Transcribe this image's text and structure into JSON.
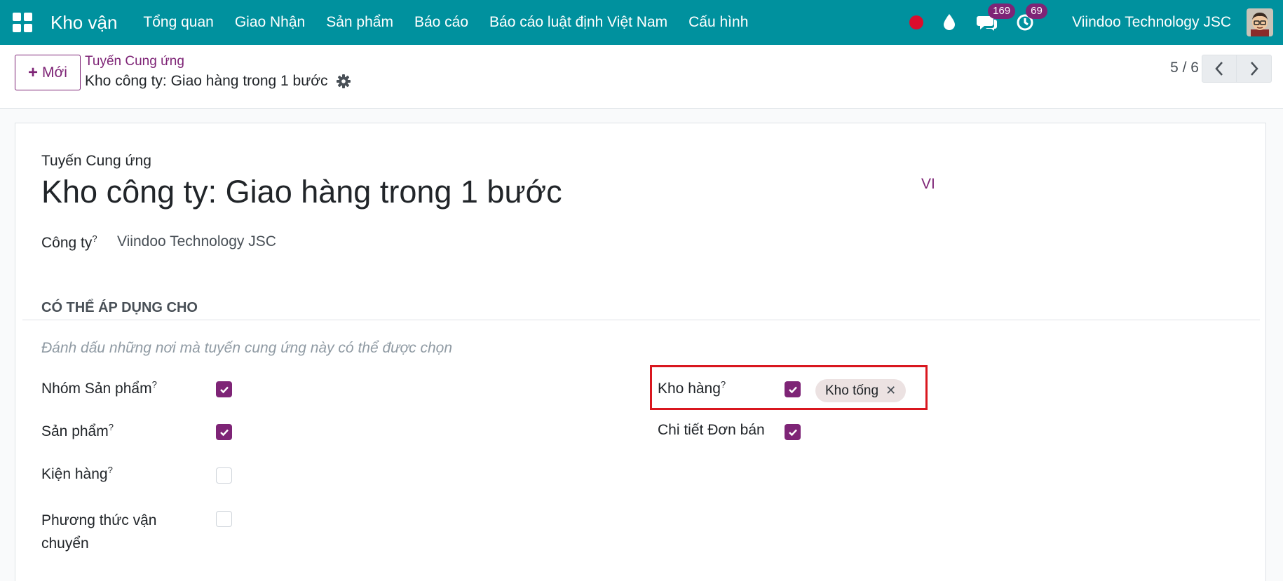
{
  "navbar": {
    "app_name": "Kho vận",
    "menu": [
      "Tổng quan",
      "Giao Nhận",
      "Sản phẩm",
      "Báo cáo",
      "Báo cáo luật định Việt Nam",
      "Cấu hình"
    ],
    "messages_count": "169",
    "activities_count": "69",
    "company": "Viindoo Technology JSC"
  },
  "control": {
    "new_label": "Mới",
    "breadcrumb_parent": "Tuyến Cung ứng",
    "breadcrumb_current": "Kho công ty: Giao hàng trong 1 bước",
    "pager": "5 / 6"
  },
  "form": {
    "subtitle": "Tuyến Cung ứng",
    "title": "Kho công ty: Giao hàng trong 1 bước",
    "lang": "VI",
    "company_label": "Công ty",
    "company_value": "Viindoo Technology JSC",
    "section_title": "CÓ THỂ ÁP DỤNG CHO",
    "help_text": "Đánh dấu những nơi mà tuyến cung ứng này có thể được chọn",
    "left_fields": [
      {
        "label": "Nhóm Sản phẩm",
        "help": "?",
        "checked": true
      },
      {
        "label": "Sản phẩm",
        "help": "?",
        "checked": true
      },
      {
        "label": "Kiện hàng",
        "help": "?",
        "checked": false
      },
      {
        "label_line1": "Phương thức vận",
        "label_line2": "chuyển",
        "checked": false
      }
    ],
    "right_fields": [
      {
        "label": "Kho hàng",
        "help": "?",
        "checked": true,
        "tag": "Kho tống"
      },
      {
        "label": "Chi tiết Đơn bán",
        "checked": true
      }
    ]
  },
  "colors": {
    "navbar": "#00919e",
    "primary": "#7e2476",
    "highlight": "#d9171f",
    "record_dot": "#dc0d2c"
  },
  "icons": [
    "apps-grid-icon",
    "record-dot-icon",
    "droplet-icon",
    "chat-icon",
    "clock-icon",
    "gear-icon",
    "chevron-left-icon",
    "chevron-right-icon",
    "check-icon",
    "close-icon"
  ]
}
